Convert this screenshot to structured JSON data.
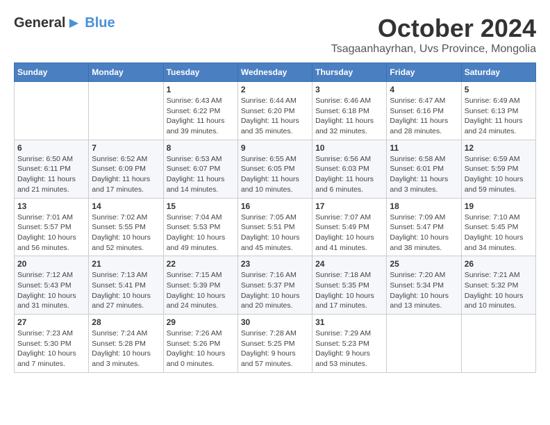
{
  "logo": {
    "general": "General",
    "blue": "Blue"
  },
  "header": {
    "month": "October 2024",
    "location": "Tsagaanhayrhan, Uvs Province, Mongolia"
  },
  "weekdays": [
    "Sunday",
    "Monday",
    "Tuesday",
    "Wednesday",
    "Thursday",
    "Friday",
    "Saturday"
  ],
  "weeks": [
    [
      {
        "day": "",
        "info": ""
      },
      {
        "day": "",
        "info": ""
      },
      {
        "day": "1",
        "info": "Sunrise: 6:43 AM\nSunset: 6:22 PM\nDaylight: 11 hours and 39 minutes."
      },
      {
        "day": "2",
        "info": "Sunrise: 6:44 AM\nSunset: 6:20 PM\nDaylight: 11 hours and 35 minutes."
      },
      {
        "day": "3",
        "info": "Sunrise: 6:46 AM\nSunset: 6:18 PM\nDaylight: 11 hours and 32 minutes."
      },
      {
        "day": "4",
        "info": "Sunrise: 6:47 AM\nSunset: 6:16 PM\nDaylight: 11 hours and 28 minutes."
      },
      {
        "day": "5",
        "info": "Sunrise: 6:49 AM\nSunset: 6:13 PM\nDaylight: 11 hours and 24 minutes."
      }
    ],
    [
      {
        "day": "6",
        "info": "Sunrise: 6:50 AM\nSunset: 6:11 PM\nDaylight: 11 hours and 21 minutes."
      },
      {
        "day": "7",
        "info": "Sunrise: 6:52 AM\nSunset: 6:09 PM\nDaylight: 11 hours and 17 minutes."
      },
      {
        "day": "8",
        "info": "Sunrise: 6:53 AM\nSunset: 6:07 PM\nDaylight: 11 hours and 14 minutes."
      },
      {
        "day": "9",
        "info": "Sunrise: 6:55 AM\nSunset: 6:05 PM\nDaylight: 11 hours and 10 minutes."
      },
      {
        "day": "10",
        "info": "Sunrise: 6:56 AM\nSunset: 6:03 PM\nDaylight: 11 hours and 6 minutes."
      },
      {
        "day": "11",
        "info": "Sunrise: 6:58 AM\nSunset: 6:01 PM\nDaylight: 11 hours and 3 minutes."
      },
      {
        "day": "12",
        "info": "Sunrise: 6:59 AM\nSunset: 5:59 PM\nDaylight: 10 hours and 59 minutes."
      }
    ],
    [
      {
        "day": "13",
        "info": "Sunrise: 7:01 AM\nSunset: 5:57 PM\nDaylight: 10 hours and 56 minutes."
      },
      {
        "day": "14",
        "info": "Sunrise: 7:02 AM\nSunset: 5:55 PM\nDaylight: 10 hours and 52 minutes."
      },
      {
        "day": "15",
        "info": "Sunrise: 7:04 AM\nSunset: 5:53 PM\nDaylight: 10 hours and 49 minutes."
      },
      {
        "day": "16",
        "info": "Sunrise: 7:05 AM\nSunset: 5:51 PM\nDaylight: 10 hours and 45 minutes."
      },
      {
        "day": "17",
        "info": "Sunrise: 7:07 AM\nSunset: 5:49 PM\nDaylight: 10 hours and 41 minutes."
      },
      {
        "day": "18",
        "info": "Sunrise: 7:09 AM\nSunset: 5:47 PM\nDaylight: 10 hours and 38 minutes."
      },
      {
        "day": "19",
        "info": "Sunrise: 7:10 AM\nSunset: 5:45 PM\nDaylight: 10 hours and 34 minutes."
      }
    ],
    [
      {
        "day": "20",
        "info": "Sunrise: 7:12 AM\nSunset: 5:43 PM\nDaylight: 10 hours and 31 minutes."
      },
      {
        "day": "21",
        "info": "Sunrise: 7:13 AM\nSunset: 5:41 PM\nDaylight: 10 hours and 27 minutes."
      },
      {
        "day": "22",
        "info": "Sunrise: 7:15 AM\nSunset: 5:39 PM\nDaylight: 10 hours and 24 minutes."
      },
      {
        "day": "23",
        "info": "Sunrise: 7:16 AM\nSunset: 5:37 PM\nDaylight: 10 hours and 20 minutes."
      },
      {
        "day": "24",
        "info": "Sunrise: 7:18 AM\nSunset: 5:35 PM\nDaylight: 10 hours and 17 minutes."
      },
      {
        "day": "25",
        "info": "Sunrise: 7:20 AM\nSunset: 5:34 PM\nDaylight: 10 hours and 13 minutes."
      },
      {
        "day": "26",
        "info": "Sunrise: 7:21 AM\nSunset: 5:32 PM\nDaylight: 10 hours and 10 minutes."
      }
    ],
    [
      {
        "day": "27",
        "info": "Sunrise: 7:23 AM\nSunset: 5:30 PM\nDaylight: 10 hours and 7 minutes."
      },
      {
        "day": "28",
        "info": "Sunrise: 7:24 AM\nSunset: 5:28 PM\nDaylight: 10 hours and 3 minutes."
      },
      {
        "day": "29",
        "info": "Sunrise: 7:26 AM\nSunset: 5:26 PM\nDaylight: 10 hours and 0 minutes."
      },
      {
        "day": "30",
        "info": "Sunrise: 7:28 AM\nSunset: 5:25 PM\nDaylight: 9 hours and 57 minutes."
      },
      {
        "day": "31",
        "info": "Sunrise: 7:29 AM\nSunset: 5:23 PM\nDaylight: 9 hours and 53 minutes."
      },
      {
        "day": "",
        "info": ""
      },
      {
        "day": "",
        "info": ""
      }
    ]
  ]
}
